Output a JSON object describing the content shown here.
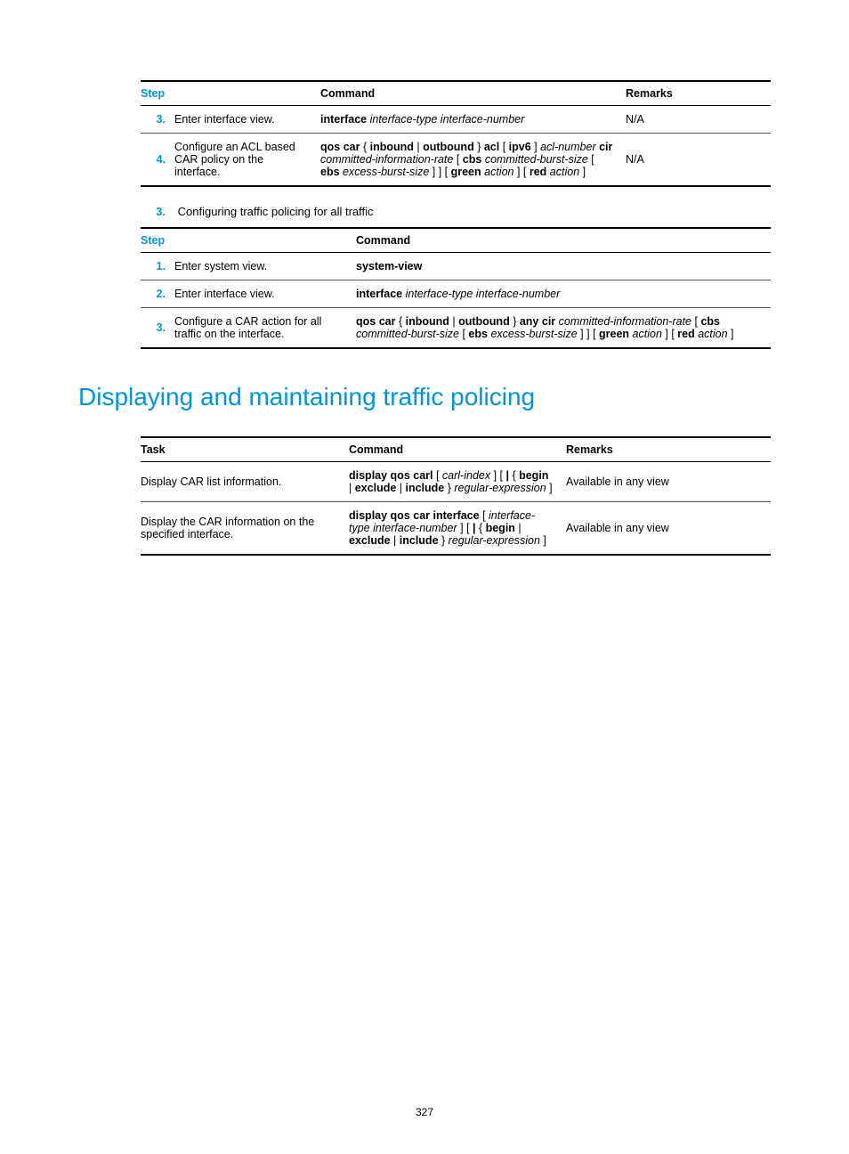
{
  "table1": {
    "headers": {
      "step": "Step",
      "command": "Command",
      "remarks": "Remarks"
    },
    "rows": [
      {
        "num": "3.",
        "desc": "Enter interface view.",
        "cmd_parts": [
          {
            "t": "interface",
            "b": true
          },
          {
            "t": " "
          },
          {
            "t": "interface-type interface-number",
            "i": true
          }
        ],
        "remarks": "N/A"
      },
      {
        "num": "4.",
        "desc": "Configure an ACL based CAR policy on the interface.",
        "cmd_parts": [
          {
            "t": "qos car",
            "b": true
          },
          {
            "t": " { "
          },
          {
            "t": "inbound",
            "b": true
          },
          {
            "t": " | "
          },
          {
            "t": "outbound",
            "b": true
          },
          {
            "t": " } "
          },
          {
            "t": "acl",
            "b": true
          },
          {
            "t": " [ "
          },
          {
            "t": "ipv6",
            "b": true
          },
          {
            "t": " ] "
          },
          {
            "t": "acl-number",
            "i": true
          },
          {
            "t": " "
          },
          {
            "t": "cir",
            "b": true
          },
          {
            "t": " "
          },
          {
            "t": "committed-information-rate",
            "i": true
          },
          {
            "t": " [ "
          },
          {
            "t": "cbs",
            "b": true
          },
          {
            "t": " "
          },
          {
            "t": "committed-burst-size",
            "i": true
          },
          {
            "t": " [ "
          },
          {
            "t": "ebs",
            "b": true
          },
          {
            "t": " "
          },
          {
            "t": "excess-burst-size",
            "i": true
          },
          {
            "t": " ] ] [ "
          },
          {
            "t": "green",
            "b": true
          },
          {
            "t": " "
          },
          {
            "t": "action",
            "i": true
          },
          {
            "t": " ] [ "
          },
          {
            "t": "red",
            "b": true
          },
          {
            "t": " "
          },
          {
            "t": "action",
            "i": true
          },
          {
            "t": " ]"
          }
        ],
        "remarks": "N/A"
      }
    ]
  },
  "intro2": {
    "num": "3.",
    "text": "Configuring traffic policing for all traffic"
  },
  "table2": {
    "headers": {
      "step": "Step",
      "command": "Command"
    },
    "rows": [
      {
        "num": "1.",
        "desc": "Enter system view.",
        "cmd_parts": [
          {
            "t": "system-view",
            "b": true
          }
        ]
      },
      {
        "num": "2.",
        "desc": "Enter interface view.",
        "cmd_parts": [
          {
            "t": "interface",
            "b": true
          },
          {
            "t": " "
          },
          {
            "t": "interface-type interface-number",
            "i": true
          }
        ]
      },
      {
        "num": "3.",
        "desc": "Configure a CAR action for all traffic on the interface.",
        "cmd_parts": [
          {
            "t": "qos car",
            "b": true
          },
          {
            "t": " { "
          },
          {
            "t": "inbound",
            "b": true
          },
          {
            "t": " | "
          },
          {
            "t": "outbound",
            "b": true
          },
          {
            "t": " } "
          },
          {
            "t": "any",
            "b": true
          },
          {
            "t": " "
          },
          {
            "t": "cir",
            "b": true
          },
          {
            "t": " "
          },
          {
            "t": "committed-information-rate",
            "i": true
          },
          {
            "t": " [ "
          },
          {
            "t": "cbs",
            "b": true
          },
          {
            "t": " "
          },
          {
            "t": "committed-burst-size",
            "i": true
          },
          {
            "t": " [ "
          },
          {
            "t": "ebs",
            "b": true
          },
          {
            "t": " "
          },
          {
            "t": "excess-burst-size",
            "i": true
          },
          {
            "t": " ] ] [ "
          },
          {
            "t": "green",
            "b": true
          },
          {
            "t": " "
          },
          {
            "t": "action",
            "i": true
          },
          {
            "t": " ] [ "
          },
          {
            "t": "red",
            "b": true
          },
          {
            "t": " "
          },
          {
            "t": "action",
            "i": true
          },
          {
            "t": " ]"
          }
        ]
      }
    ]
  },
  "section_title": "Displaying and maintaining traffic policing",
  "table3": {
    "headers": {
      "task": "Task",
      "command": "Command",
      "remarks": "Remarks"
    },
    "rows": [
      {
        "task": "Display CAR list information.",
        "cmd_parts": [
          {
            "t": "display qos carl",
            "b": true
          },
          {
            "t": " [ "
          },
          {
            "t": "carl-index",
            "i": true
          },
          {
            "t": " ] [ "
          },
          {
            "t": "|",
            "b": true
          },
          {
            "t": " { "
          },
          {
            "t": "begin",
            "b": true
          },
          {
            "t": " | "
          },
          {
            "t": "exclude",
            "b": true
          },
          {
            "t": " | "
          },
          {
            "t": "include",
            "b": true
          },
          {
            "t": " } "
          },
          {
            "t": "regular-expression",
            "i": true
          },
          {
            "t": " ]"
          }
        ],
        "remarks": "Available in any view"
      },
      {
        "task": "Display the CAR information on the specified interface.",
        "cmd_parts": [
          {
            "t": "display qos car interface",
            "b": true
          },
          {
            "t": " [ "
          },
          {
            "t": "interface-type interface-number",
            "i": true
          },
          {
            "t": " ] [ "
          },
          {
            "t": "|",
            "b": true
          },
          {
            "t": " { "
          },
          {
            "t": "begin",
            "b": true
          },
          {
            "t": " | "
          },
          {
            "t": "exclude",
            "b": true
          },
          {
            "t": " | "
          },
          {
            "t": "include",
            "b": true
          },
          {
            "t": " } "
          },
          {
            "t": "regular-expression",
            "i": true
          },
          {
            "t": " ]"
          }
        ],
        "remarks": "Available in any view"
      }
    ]
  },
  "page_number": "327"
}
